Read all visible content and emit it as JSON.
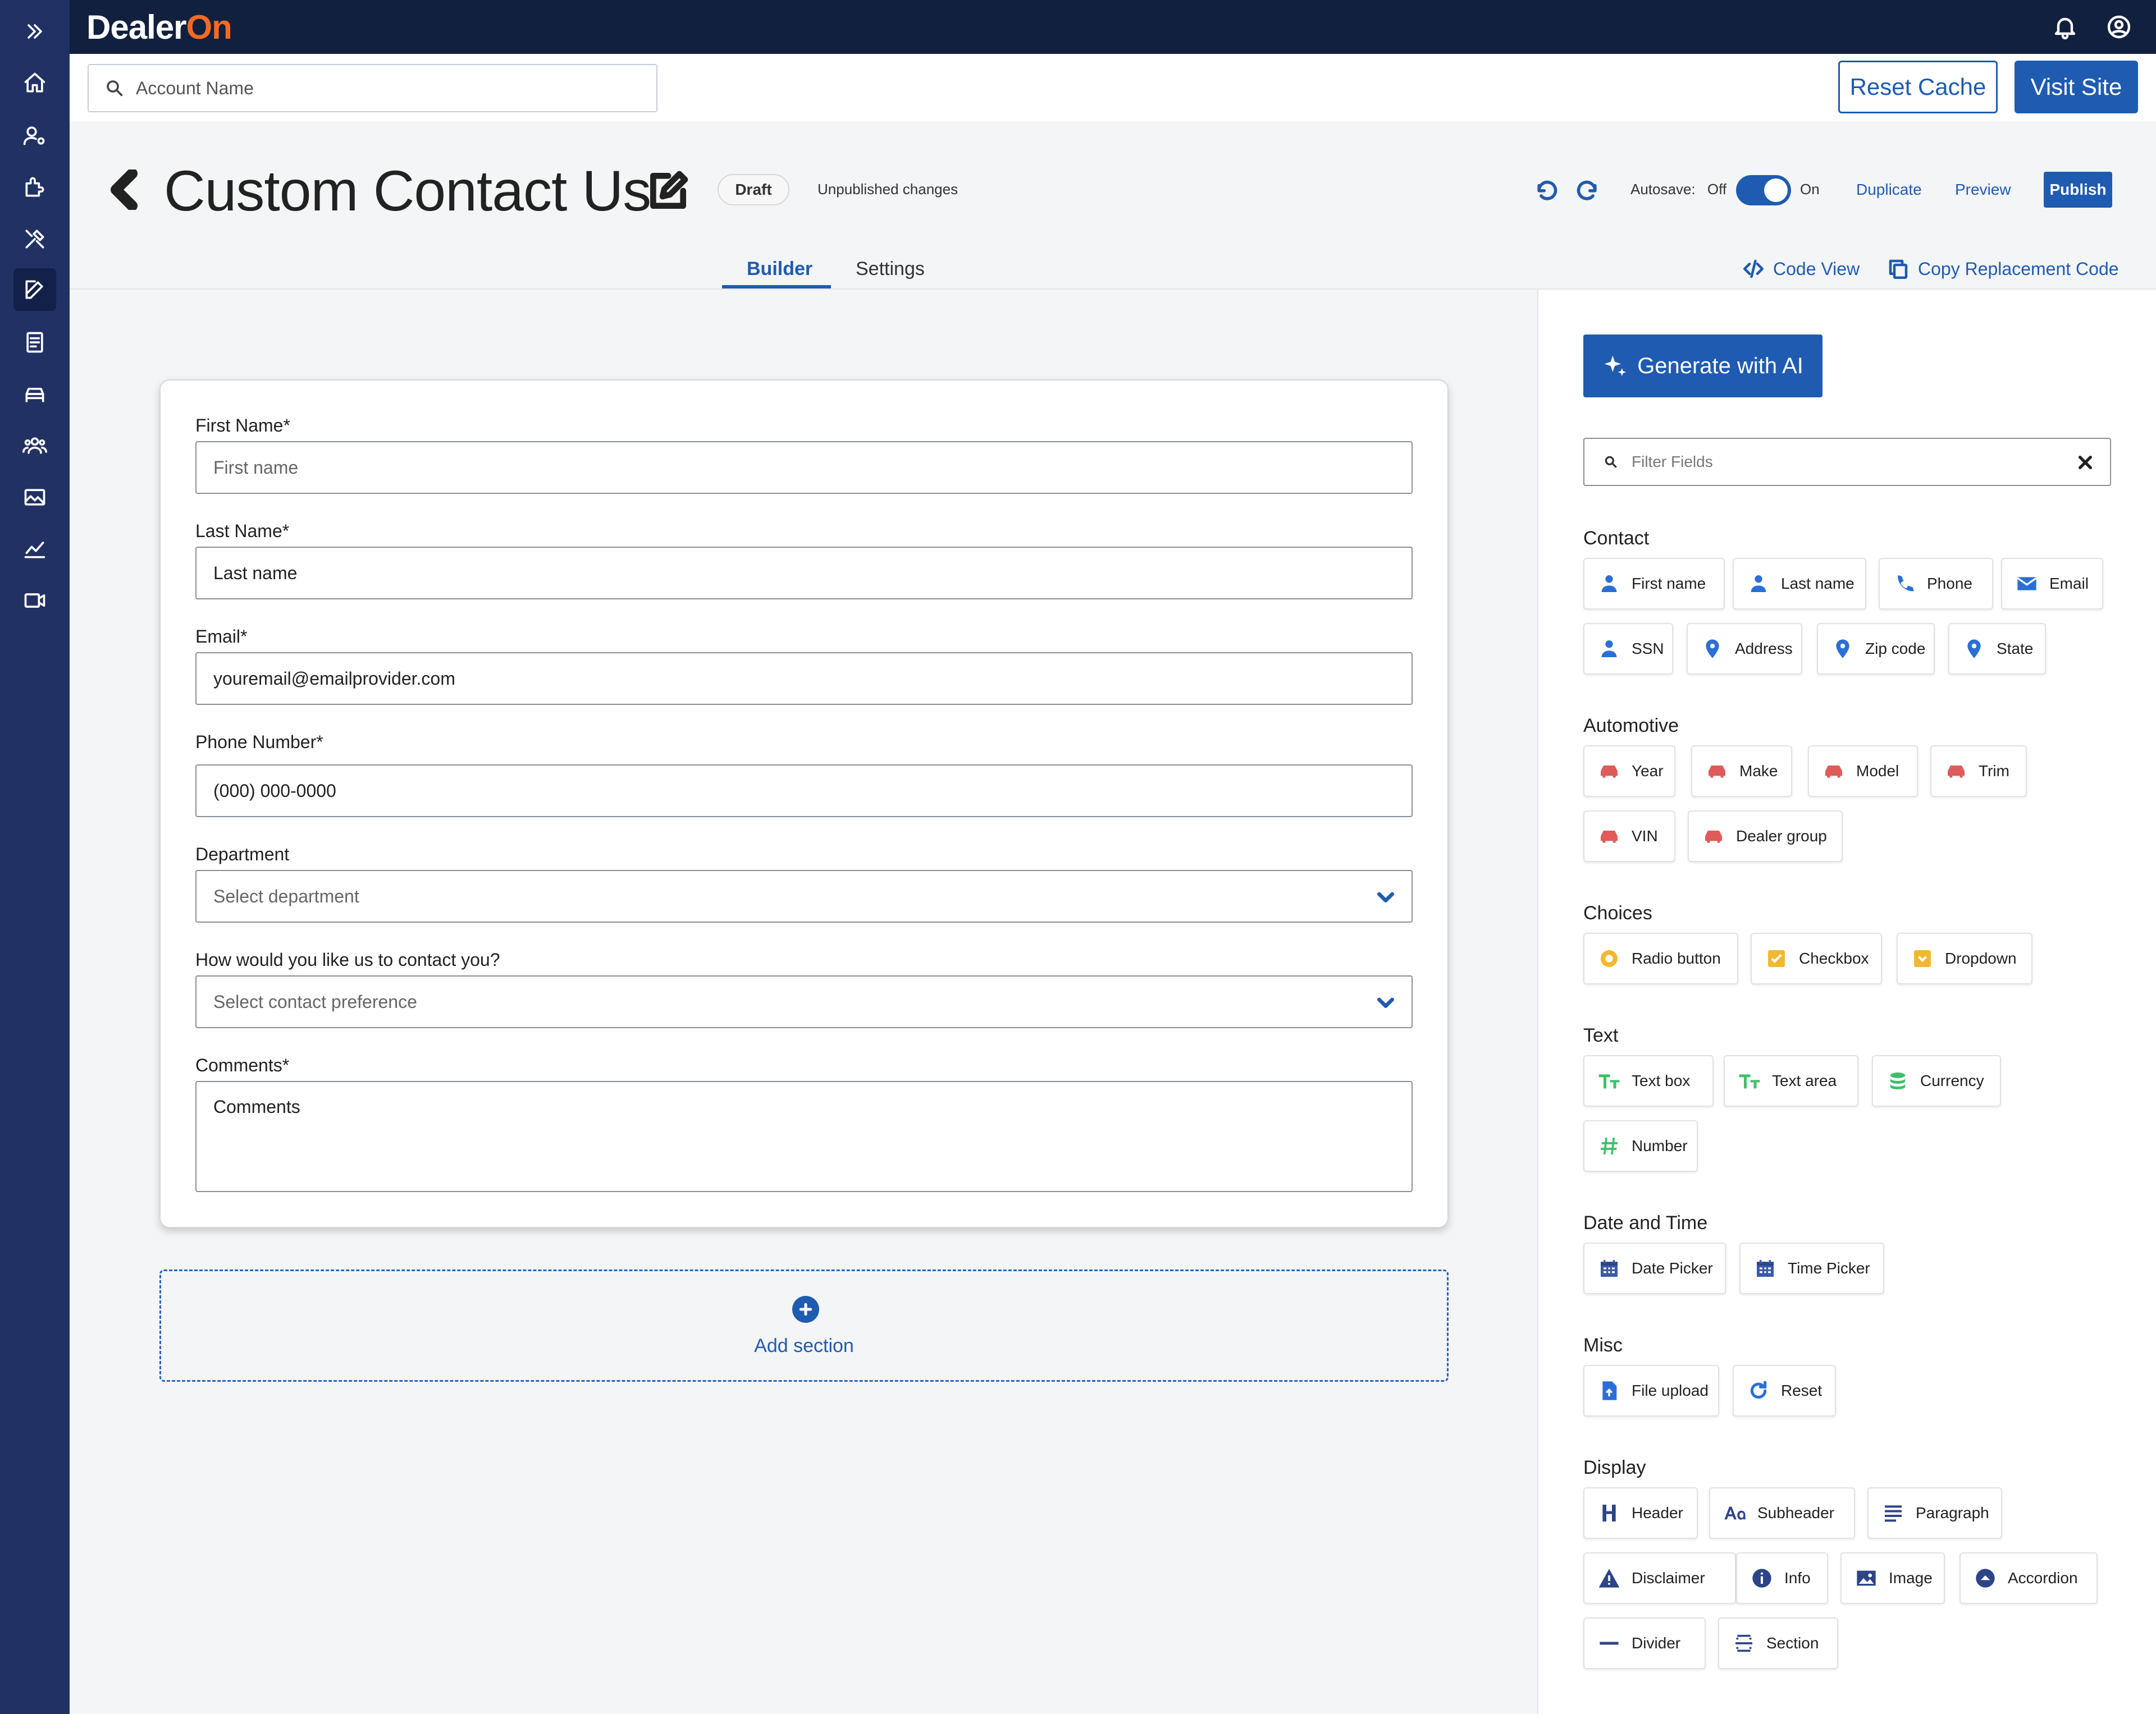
{
  "topbar": {
    "logo_dealer": "Dealer",
    "logo_on": "On",
    "notifications_icon": "bell-icon",
    "account_icon": "user-circle-icon"
  },
  "subbar": {
    "account_placeholder": "Account Name",
    "reset_cache": "Reset Cache",
    "visit_site": "Visit Site"
  },
  "page": {
    "title": "Custom Contact Us",
    "status": "Draft",
    "unpublished": "Unpublished changes",
    "autosave_label": "Autosave:",
    "autosave_off": "Off",
    "autosave_on": "On",
    "autosave_enabled": true,
    "duplicate": "Duplicate",
    "preview": "Preview",
    "publish": "Publish"
  },
  "tabs": {
    "builder": "Builder",
    "settings": "Settings",
    "active": "Builder"
  },
  "tools": {
    "code_view": "Code View",
    "copy_code": "Copy Replacement Code"
  },
  "form": {
    "first_name": {
      "label": "First Name*",
      "placeholder": "First name"
    },
    "last_name": {
      "label": "Last Name*",
      "value": "Last name"
    },
    "email": {
      "label": "Email*",
      "value": "youremail@emailprovider.com"
    },
    "phone": {
      "label": "Phone Number*",
      "value": "(000) 000-0000"
    },
    "department": {
      "label": "Department",
      "placeholder": "Select department"
    },
    "contact_pref": {
      "label": "How would you like us to contact you?",
      "placeholder": "Select contact preference"
    },
    "comments": {
      "label": "Comments*",
      "value": "Comments"
    },
    "add_section": "Add section"
  },
  "panel": {
    "generate_ai": "Generate with AI",
    "filter_placeholder": "Filter Fields",
    "groups": {
      "contact": {
        "title": "Contact",
        "items": [
          "First name",
          "Last name",
          "Phone",
          "Email",
          "SSN",
          "Address",
          "Zip code",
          "State"
        ]
      },
      "automotive": {
        "title": "Automotive",
        "items": [
          "Year",
          "Make",
          "Model",
          "Trim",
          "VIN",
          "Dealer group"
        ]
      },
      "choices": {
        "title": "Choices",
        "items": [
          "Radio button",
          "Checkbox",
          "Dropdown"
        ]
      },
      "text": {
        "title": "Text",
        "items": [
          "Text box",
          "Text area",
          "Currency",
          "Number"
        ]
      },
      "datetime": {
        "title": "Date and Time",
        "items": [
          "Date Picker",
          "Time Picker"
        ]
      },
      "misc": {
        "title": "Misc",
        "items": [
          "File upload",
          "Reset"
        ]
      },
      "display": {
        "title": "Display",
        "items": [
          "Header",
          "Subheader",
          "Paragraph",
          "Disclaimer",
          "Info",
          "Image",
          "Accordion",
          "Divider",
          "Section"
        ]
      }
    }
  },
  "colors": {
    "brand": "#1f5bb0",
    "rail": "#213164",
    "topbar": "#12203f",
    "logo_accent": "#f26b21",
    "contact_icon": "#2a6fd6",
    "auto_icon": "#e05a5a",
    "choice_icon": "#f2b830",
    "text_icon": "#3fbf6a"
  }
}
